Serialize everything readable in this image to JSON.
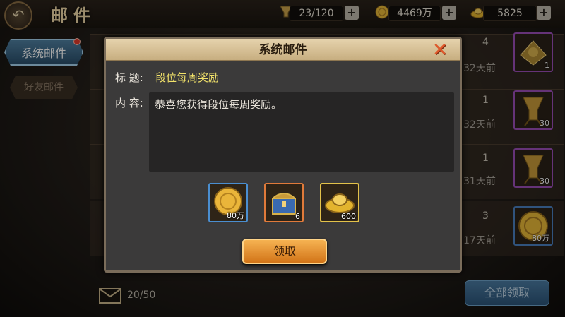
{
  "header": {
    "title": "邮件",
    "back_icon": "back-arrow-icon"
  },
  "resources": [
    {
      "icon": "stamina-cup-icon",
      "value": "23/120"
    },
    {
      "icon": "gold-coin-icon",
      "value": "4469万"
    },
    {
      "icon": "gold-ingot-icon",
      "value": "5825"
    }
  ],
  "plus_label": "+",
  "sidebar": {
    "tabs": [
      {
        "label": "系统邮件",
        "active": true,
        "has_badge": true
      },
      {
        "label": "好友邮件",
        "active": false
      }
    ]
  },
  "mail_list": [
    {
      "count": "4",
      "days": "32天前",
      "item_icon": "title-badge-icon",
      "item_count": "1"
    },
    {
      "count": "1",
      "days": "32天前",
      "item_icon": "bronze-cup-icon",
      "item_count": "30"
    },
    {
      "count": "1",
      "days": "31天前",
      "item_icon": "bronze-cup-icon",
      "item_count": "30"
    },
    {
      "count": "3",
      "days": "17天前",
      "item_icon": "gold-coin-icon",
      "item_count": "80万"
    }
  ],
  "footer": {
    "mail_count": "20/50",
    "claim_all_label": "全部领取"
  },
  "modal": {
    "title": "系统邮件",
    "subject_label": "标 题:",
    "subject": "段位每周奖励",
    "content_label": "内 容:",
    "content": "恭喜您获得段位每周奖励。",
    "rewards": [
      {
        "icon": "gold-coin-icon",
        "count": "80万",
        "rarity": "blue"
      },
      {
        "icon": "treasure-chest-icon",
        "count": "6",
        "rarity": "orange"
      },
      {
        "icon": "gold-ingot-icon",
        "count": "600",
        "rarity": "yellow"
      }
    ],
    "claim_label": "领取",
    "close_icon": "close-x-icon"
  }
}
